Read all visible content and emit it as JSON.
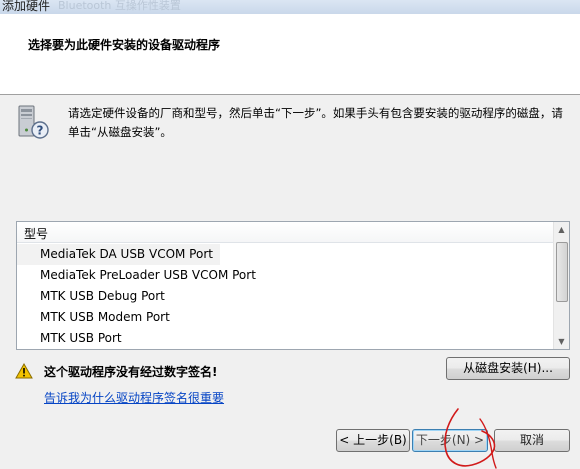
{
  "window": {
    "title": "添加硬件",
    "ghost_text": "Bluetooth 互操作性装置"
  },
  "header": {
    "title": "选择要为此硬件安装的设备驱动程序"
  },
  "instruction": {
    "text": "请选定硬件设备的厂商和型号，然后单击“下一步”。如果手头有包含要安装的驱动程序的磁盘，请单击“从磁盘安装”。"
  },
  "device_list": {
    "column_header": "型号",
    "items": [
      "MediaTek DA USB VCOM Port",
      "MediaTek PreLoader USB VCOM Port",
      "MTK USB Debug Port",
      "MTK USB Modem Port",
      "MTK USB Port"
    ],
    "selected_index": 0
  },
  "warning": {
    "text": "这个驱动程序没有经过数字签名!",
    "link": "告诉我为什么驱动程序签名很重要"
  },
  "buttons": {
    "have_disk": "从磁盘安装(H)...",
    "back": "< 上一步(B)",
    "next": "下一步(N) >",
    "cancel": "取消"
  },
  "colors": {
    "link": "#0645c5",
    "warning": "#f2c200",
    "annotation": "#d11a1a"
  },
  "icons": {
    "hardware": "computer-tower-help-icon",
    "warning": "warning-triangle-icon"
  }
}
